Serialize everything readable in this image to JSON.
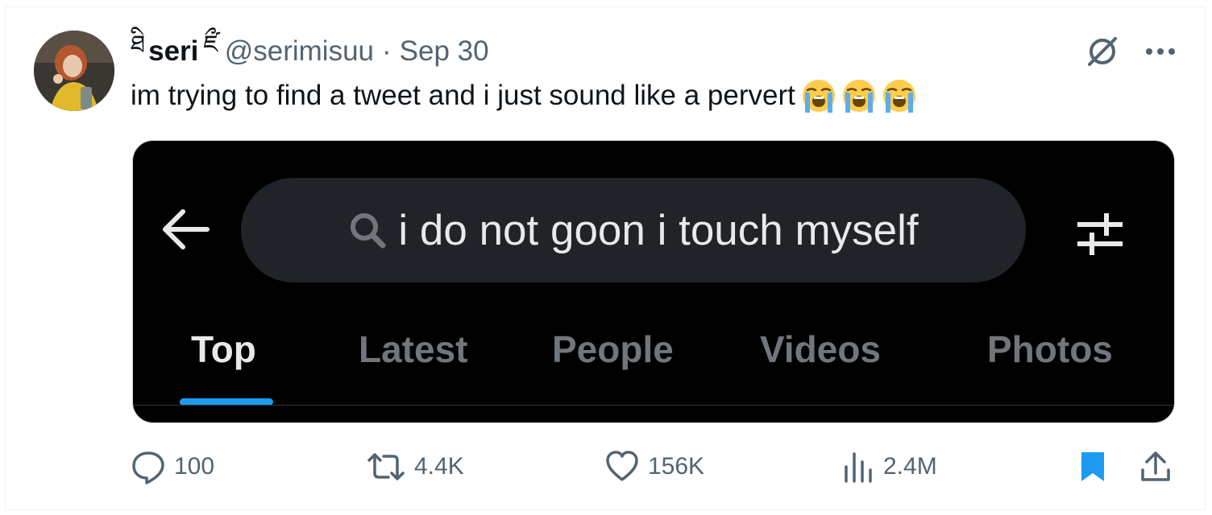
{
  "tweet": {
    "author": {
      "display_name": "seri",
      "name_prefix_glyph": "ཐི",
      "name_suffix_glyph": "ཛྀ",
      "handle": "@serimisuu"
    },
    "separator": "·",
    "date": "Sep 30",
    "text": "im trying to find a tweet and i just sound like a pervert",
    "emojis": [
      "loudly-crying-face",
      "loudly-crying-face",
      "loudly-crying-face"
    ]
  },
  "media": {
    "search_query": "i do not goon i touch myself",
    "tabs": [
      {
        "label": "Top",
        "active": true
      },
      {
        "label": "Latest",
        "active": false
      },
      {
        "label": "People",
        "active": false
      },
      {
        "label": "Videos",
        "active": false
      },
      {
        "label": "Photos",
        "active": false
      }
    ],
    "accent_color": "#1d9bf0"
  },
  "actions": {
    "replies": "100",
    "reposts": "4.4K",
    "likes": "156K",
    "views": "2.4M"
  },
  "icons": {
    "grok": "grok-icon",
    "more": "more-icon",
    "reply": "reply-icon",
    "repost": "repost-icon",
    "like": "heart-icon",
    "views": "analytics-icon",
    "bookmark": "bookmark-icon",
    "share": "share-icon"
  },
  "colors": {
    "text_primary": "#0f1419",
    "text_secondary": "#536471",
    "bookmark_active": "#1d9bf0"
  }
}
